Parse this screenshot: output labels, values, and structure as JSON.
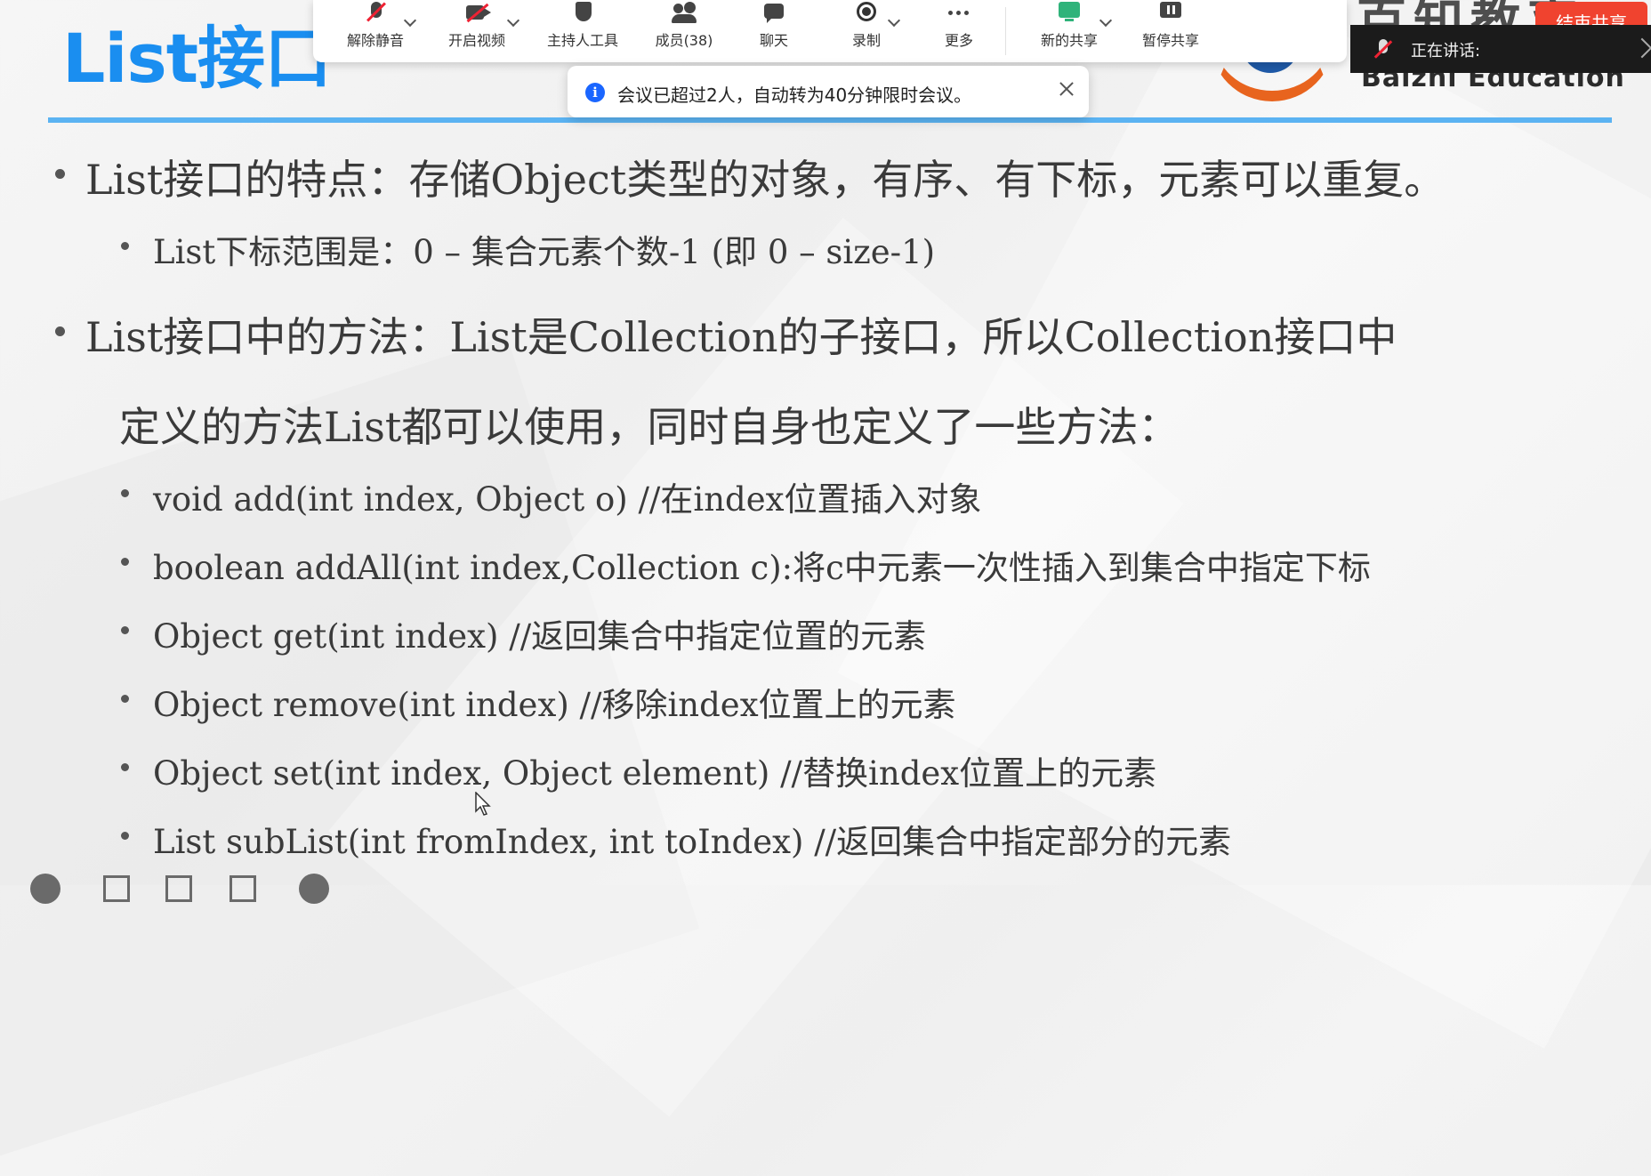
{
  "slide": {
    "title": "List接口",
    "brand_cn": "百知教育",
    "brand_en": "Baizhi Education",
    "lines": [
      "List接口的特点：存储Object类型的对象，有序、有下标，元素可以重复。",
      "List下标范围是：0 – 集合元素个数-1 (即 0 – size-1)",
      "List接口中的方法：List是Collection的子接口，所以Collection接口中",
      "定义的方法List都可以使用，同时自身也定义了一些方法：",
      "void add(int index, Object o) //在index位置插入对象",
      "boolean addAll(int index,Collection c):将c中元素一次性插入到集合中指定下标",
      "Object get(int index) //返回集合中指定位置的元素",
      "Object remove(int index) //移除index位置上的元素",
      "Object set(int index, Object element) //替换index位置上的元素",
      "List subList(int fromIndex, int toIndex) //返回集合中指定部分的元素"
    ]
  },
  "toolbar": {
    "unmute": "解除静音",
    "start_video": "开启视频",
    "host_tools": "主持人工具",
    "members": "成员(38)",
    "chat": "聊天",
    "record": "录制",
    "more": "更多",
    "new_share": "新的共享",
    "pause_share": "暂停共享",
    "end_share": "结束共享"
  },
  "toast": {
    "message": "会议已超过2人，自动转为40分钟限时会议。"
  },
  "speaking": {
    "label": "正在讲话:"
  },
  "colors": {
    "title_blue": "#1a8ef0",
    "rule_blue": "#5bb3f2",
    "end_share_red": "#f0432f",
    "info_blue": "#1a66ff",
    "share_green": "#2fb37a"
  }
}
